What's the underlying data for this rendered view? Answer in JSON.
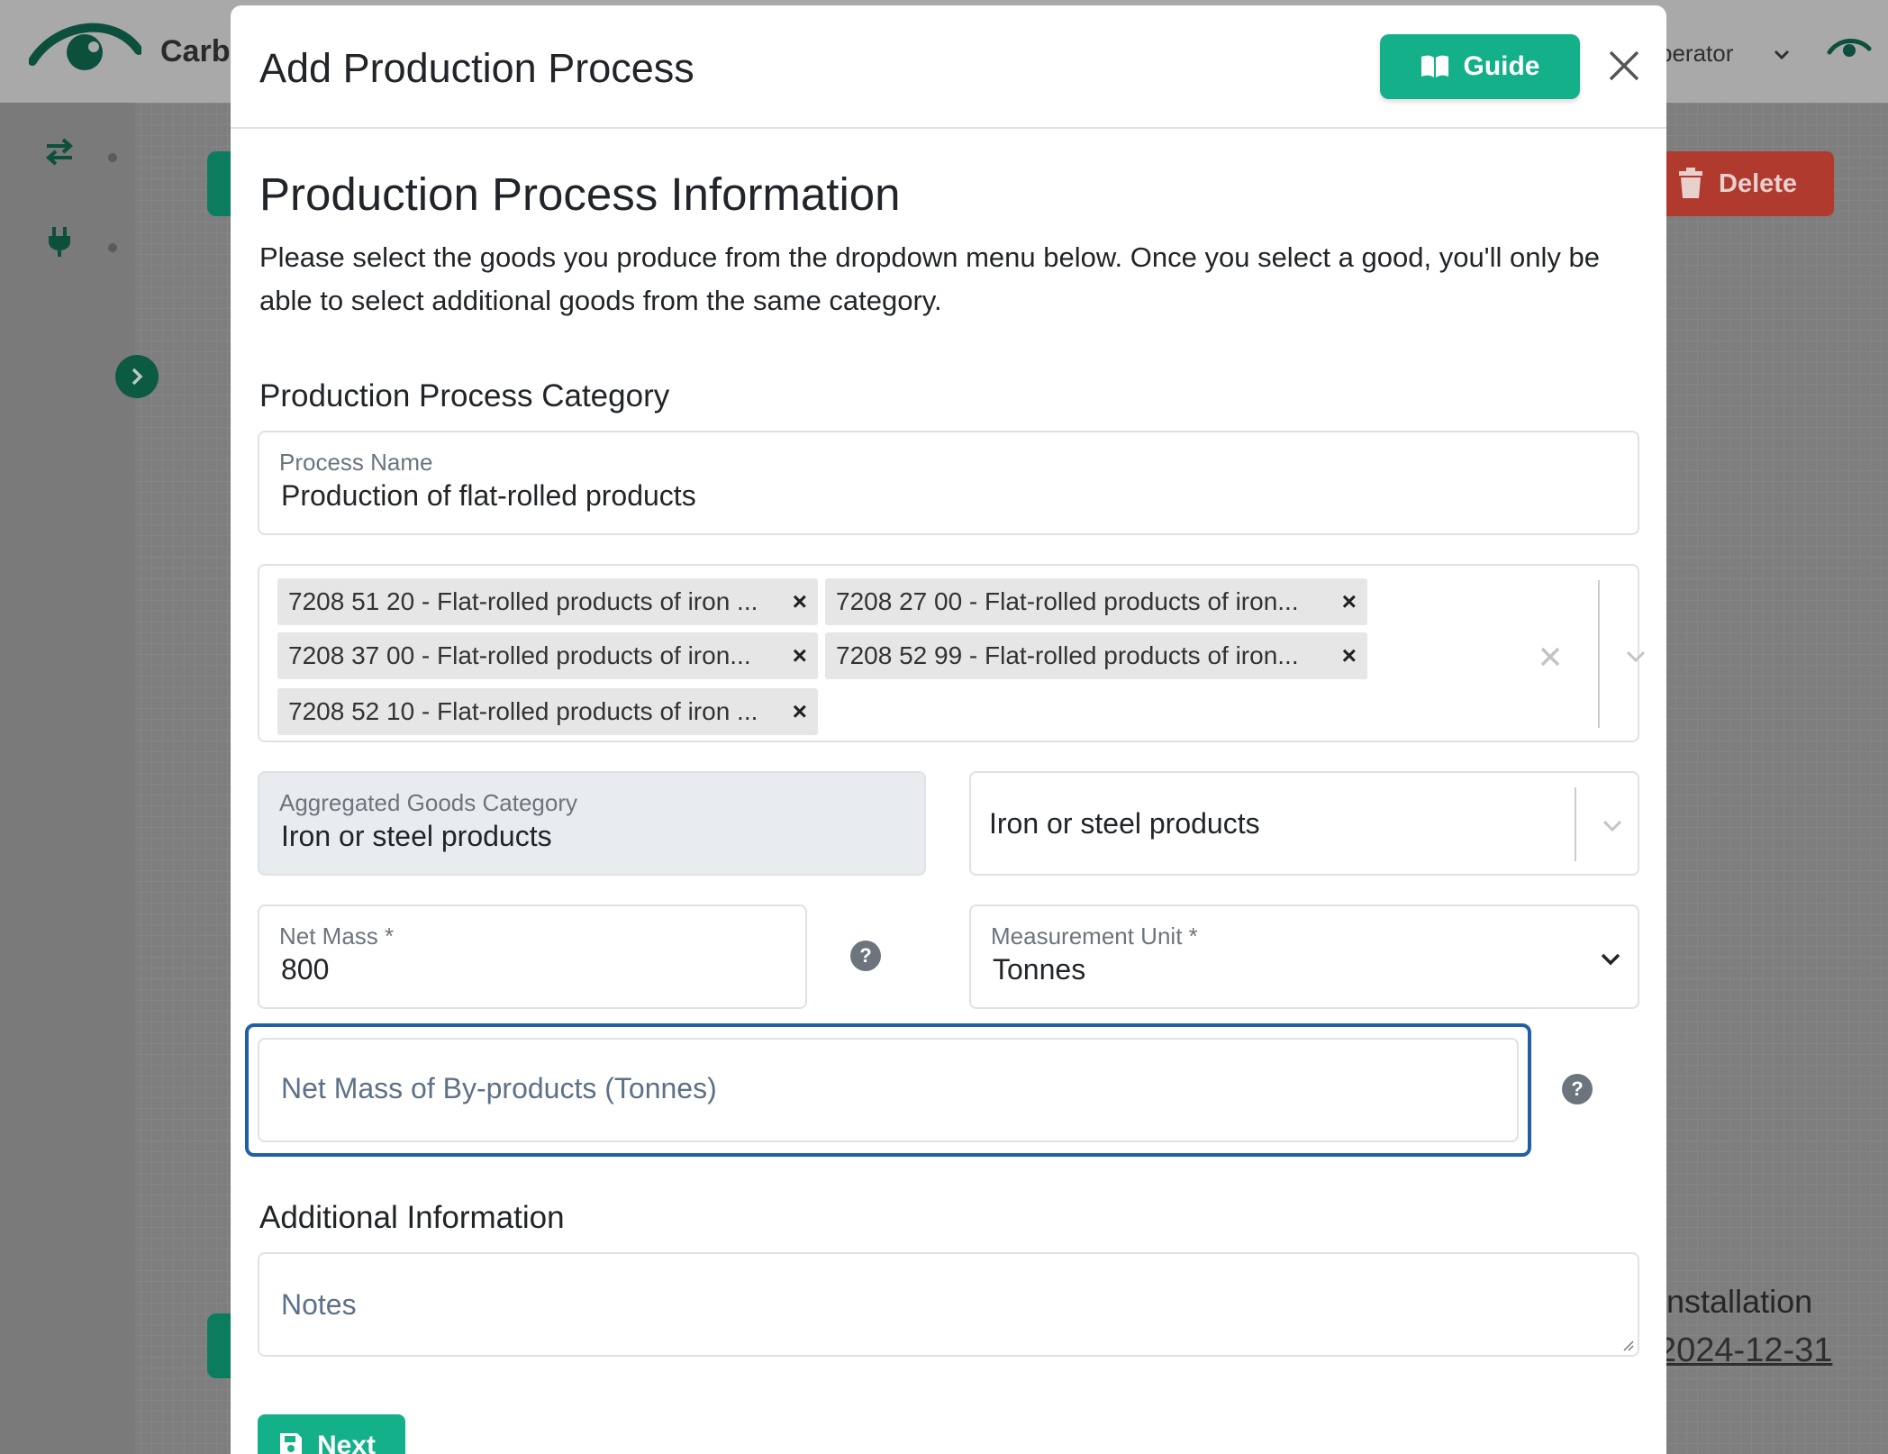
{
  "background": {
    "brand": "Carb",
    "operator_label": "perator",
    "delete_label": "Delete",
    "installation_label": "Installation",
    "date_label": "2024-12-31"
  },
  "modal": {
    "title": "Add Production Process",
    "guide_label": "Guide",
    "section_title": "Production Process Information",
    "intro_text": "Please select the goods you produce from the dropdown menu below. Once you select a good, you'll only be able to select additional goods from the same category.",
    "category_heading": "Production Process Category",
    "process_name": {
      "label": "Process Name",
      "value": "Production of flat-rolled products"
    },
    "goods_tags": [
      "7208 51 20 - Flat-rolled products of iron ...",
      "7208 27 00 - Flat-rolled products of iron...",
      "7208 37 00 - Flat-rolled products of iron...",
      "7208 52 99 - Flat-rolled products of iron...",
      "7208 52 10 - Flat-rolled products of iron ..."
    ],
    "tag_remove_symbol": "×",
    "aggregated_category": {
      "label": "Aggregated Goods Category",
      "value": "Iron or steel products"
    },
    "category_select": {
      "value": "Iron or steel products"
    },
    "net_mass": {
      "label": "Net Mass *",
      "value": "800"
    },
    "measurement_unit": {
      "label": "Measurement Unit *",
      "value": "Tonnes"
    },
    "byproducts": {
      "placeholder": "Net Mass of By-products (Tonnes)"
    },
    "help_symbol": "?",
    "additional_heading": "Additional Information",
    "notes": {
      "placeholder": "Notes"
    },
    "next_label": "Next"
  },
  "colors": {
    "primary_green": "#14b08a",
    "focus_blue": "#1f5fa8",
    "delete_red": "#b03a2e",
    "disabled_gray": "#e9ecef"
  }
}
